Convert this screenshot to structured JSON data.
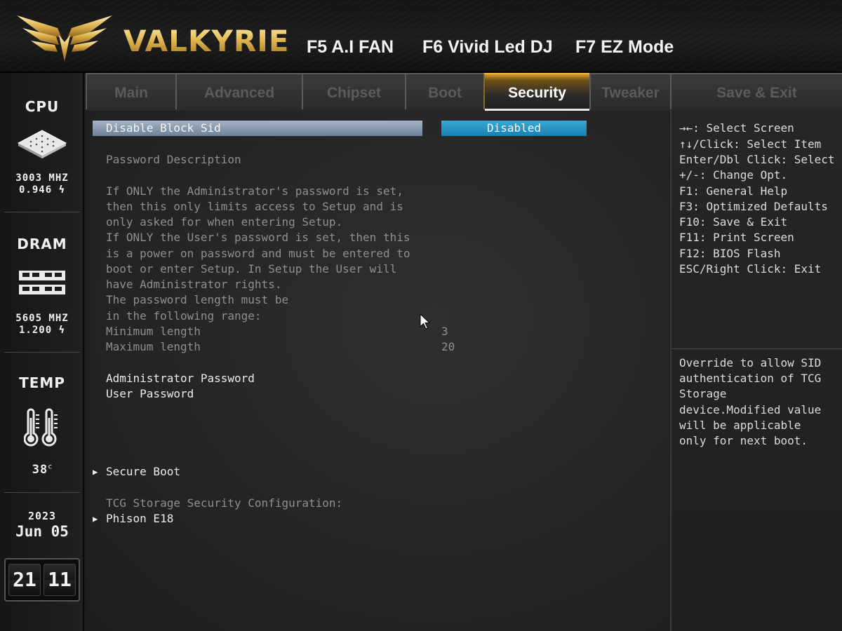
{
  "header": {
    "logo_text": "VALKYRIE",
    "hotkeys": [
      "F5 A.I FAN",
      "F6 Vivid Led DJ",
      "F7 EZ Mode"
    ],
    "logo_color": "#e2b850"
  },
  "sidebar": {
    "cpu": {
      "title": "CPU",
      "freq": "3003 MHZ",
      "volt": "0.946"
    },
    "dram": {
      "title": "DRAM",
      "freq": "5605 MHZ",
      "volt": "1.200"
    },
    "temp": {
      "title": "TEMP",
      "value": "38",
      "unit": "c"
    },
    "date": {
      "year": "2023",
      "day": "Jun 05"
    },
    "clock": {
      "hours": "21",
      "minutes": "11"
    }
  },
  "tabs": [
    {
      "label": "Main",
      "active": false
    },
    {
      "label": "Advanced",
      "active": false
    },
    {
      "label": "Chipset",
      "active": false
    },
    {
      "label": "Boot",
      "active": false
    },
    {
      "label": "Security",
      "active": true
    },
    {
      "label": "Tweaker",
      "active": false
    },
    {
      "label": "Save & Exit",
      "active": false
    }
  ],
  "main": {
    "selected_item": {
      "label": "Disable Block Sid",
      "value": "Disabled"
    },
    "password_description_title": "Password Description",
    "description_lines": [
      "If ONLY the Administrator's password is set,",
      "then this only limits access to Setup and is",
      "only asked for when entering Setup.",
      "If ONLY the User's password is set, then this",
      "is a power on password and must be entered to",
      "boot or enter Setup. In Setup the User will",
      "have Administrator rights.",
      "The password length must be",
      "in the following range:"
    ],
    "min_length": {
      "label": "Minimum length",
      "value": "3"
    },
    "max_length": {
      "label": "Maximum length",
      "value": "20"
    },
    "admin_password": "Administrator Password",
    "user_password": "User Password",
    "secure_boot": "Secure Boot",
    "tcg_title": "TCG Storage Security Configuration:",
    "tcg_device": "Phison E18"
  },
  "help": {
    "keys": [
      "→←: Select Screen",
      "↑↓/Click: Select Item",
      "Enter/Dbl Click: Select",
      "+/-: Change Opt.",
      "F1: General Help",
      "F3: Optimized Defaults",
      "F10: Save & Exit",
      "F11: Print Screen",
      "F12: BIOS Flash",
      "ESC/Right Click: Exit"
    ],
    "description": [
      "Override to allow SID",
      "authentication of TCG",
      "Storage",
      "device.Modified value",
      "will be applicable",
      "only for next boot."
    ]
  },
  "colors": {
    "active_tab_accent": "#f0b640",
    "selection_bar": "#8ea0b5",
    "value_box": "#2a96c5"
  }
}
